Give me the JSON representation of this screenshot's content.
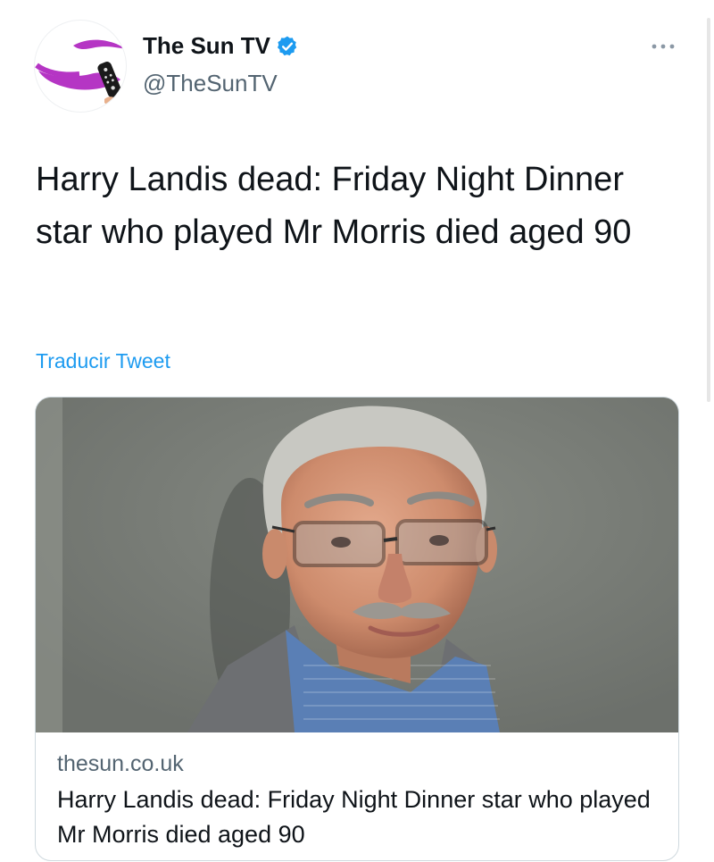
{
  "author": {
    "display_name": "The Sun TV",
    "handle": "@TheSunTV",
    "verified": true
  },
  "tweet": {
    "text": "Harry Landis dead: Friday Night Dinner star who played Mr Morris died aged 90",
    "translate_label": "Traducir Tweet"
  },
  "card": {
    "domain": "thesun.co.uk",
    "title": "Harry Landis dead: Friday Night Dinner star who played Mr Morris died aged 90"
  },
  "colors": {
    "link_blue": "#1d9bf0",
    "secondary_text": "#536471",
    "brand_purple": "#b535c4"
  }
}
